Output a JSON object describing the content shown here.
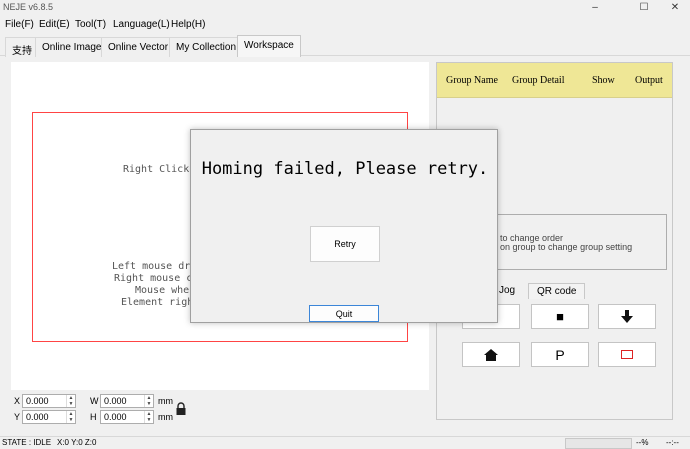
{
  "window": {
    "title": "NEJE v6.8.5",
    "minimize": "–",
    "maximize": "☐",
    "close": "✕"
  },
  "menu": [
    "File(F)",
    "Edit(E)",
    "Tool(T)",
    "Language(L)",
    "Help(H)"
  ],
  "tabs": [
    "支持",
    "Online Image",
    "Online Vector",
    "My Collection",
    "Workspace"
  ],
  "active_tab": "Workspace",
  "canvas": {
    "hints": {
      "right_click": "Right Click",
      "left_mouse": "Left mouse dr",
      "right_mouse": "Right mouse c",
      "mouse_wheel": "Mouse whe",
      "element_right": "Element righ"
    }
  },
  "coords": {
    "x_label": "X",
    "x_value": "0.000",
    "y_label": "Y",
    "y_value": "0.000",
    "w_label": "W",
    "w_value": "0.000",
    "h_label": "H",
    "h_value": "0.000",
    "unit": "mm"
  },
  "group_table": {
    "headers": [
      "Group Name",
      "Group Detail",
      "Show",
      "Output"
    ],
    "header_color": "#efe796"
  },
  "info": {
    "line1": "to change order",
    "line2": "on group to change group setting"
  },
  "subtabs": [
    "Jog",
    "QR code"
  ],
  "controls": {
    "stop_icon": "■",
    "down_icon": "🡇",
    "home_icon": "⌂",
    "p_label": "P",
    "frame_icon": "□"
  },
  "dialog": {
    "message": "Homing failed, Please retry.",
    "retry_label": "Retry",
    "quit_label": "Quit"
  },
  "status": {
    "state": "STATE : IDLE",
    "position": "X:0 Y:0 Z:0",
    "percent": "--%",
    "time": "--:--"
  }
}
